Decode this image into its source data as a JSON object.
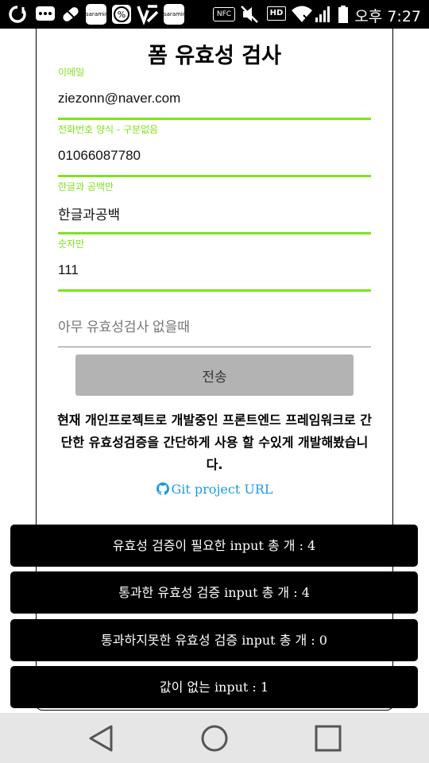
{
  "status_bar": {
    "app_icons": [
      "saramin",
      "saramin"
    ],
    "nfc_label": "NFC",
    "hd_label": "HD",
    "time": "오후 7:27",
    "icons": [
      "opera-icon",
      "chat-icon",
      "pill-icon",
      "saramin-icon",
      "percent-icon",
      "vector-icon",
      "saramin-icon",
      "nfc-icon",
      "mute-icon",
      "hd-icon",
      "wifi-icon",
      "signal-icon",
      "battery-icon"
    ]
  },
  "form": {
    "title": "폼 유효성 검사",
    "fields": [
      {
        "label": "이메일",
        "value": "ziezonn@naver.com",
        "validated": true
      },
      {
        "label": "전화번호 양식 - 구분없음",
        "value": "01066087780",
        "validated": true
      },
      {
        "label": "한글과 공백만",
        "value": "한글과공백",
        "validated": true
      },
      {
        "label": "숫자만",
        "value": "111",
        "validated": true
      },
      {
        "label": "",
        "placeholder": "아무 유효성검사 없을때",
        "value": "",
        "validated": false
      }
    ],
    "submit_label": "전송",
    "description": "현재 개인프로젝트로 개발중인 프론트엔드 프레임워크로 간단한 유효성검증을 간단하게 사용 할 수있게 개발해봤습니다.",
    "git_link_label": "Git project URL"
  },
  "summary": [
    "유효성 검증이 필요한 input 총 개 : 4",
    "통과한 유효성 검증 input 총 개 : 4",
    "통과하지못한 유효성 검증 input 총 개 : 0",
    "값이 없는 input : 1"
  ],
  "colors": {
    "valid_accent": "#7fe31b",
    "link": "#1b9be0",
    "button_bg": "#b3b3b3",
    "summary_bg": "#000000"
  }
}
